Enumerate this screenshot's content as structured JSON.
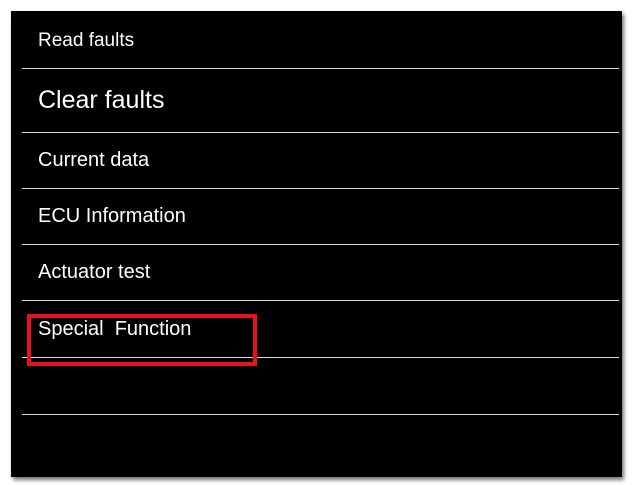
{
  "menu": {
    "items": [
      {
        "label": "Read faults"
      },
      {
        "label": "Clear faults"
      },
      {
        "label": "Current data"
      },
      {
        "label": "ECU Information"
      },
      {
        "label": "Actuator test"
      },
      {
        "label": "Special  Function"
      },
      {
        "label": ""
      },
      {
        "label": ""
      }
    ]
  },
  "highlight": {
    "color": "#e8121a",
    "target": "Special  Function"
  },
  "colors": {
    "background": "#000000",
    "text": "#ffffff",
    "divider": "#d9d9d9"
  }
}
